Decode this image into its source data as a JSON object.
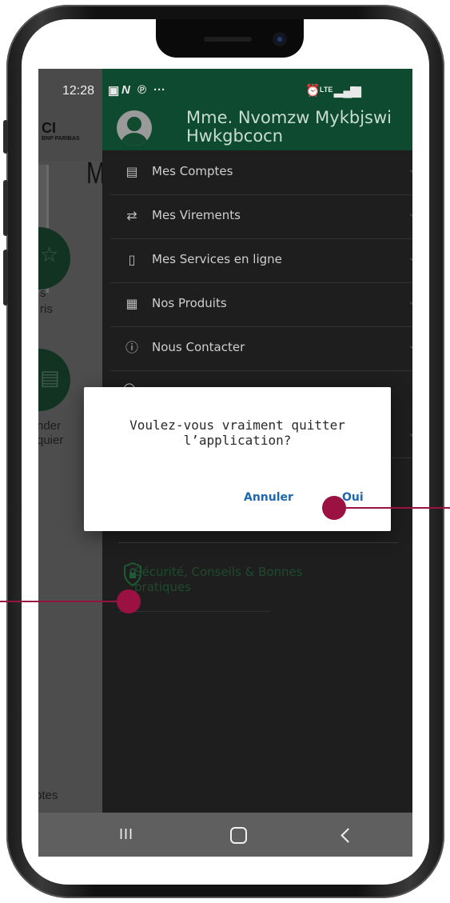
{
  "status_bar": {
    "time": "12:28",
    "left_icons": [
      "image-icon",
      "n-icon",
      "pinterest-icon",
      "more-icon"
    ],
    "right_icons": [
      "alarm-icon",
      "lte-icon",
      "signal-icon",
      "battery-icon"
    ],
    "lte_label": "LTE"
  },
  "background_app": {
    "logo": "CI",
    "logo_sub": "BNP PARIBAS",
    "title_letter": "M",
    "fav_line1": "s",
    "fav_line2": "ris",
    "demand_line1": "nder",
    "demand_line2": "quier",
    "comptes": "ptes"
  },
  "drawer": {
    "user_name": "Mme. Nvomzw Mykbjswi Hwkgbcocn",
    "menu": [
      {
        "label": "Mes Comptes",
        "icon": "accounts-icon"
      },
      {
        "label": "Mes Virements",
        "icon": "transfers-icon"
      },
      {
        "label": "Mes Services en ligne",
        "icon": "online-services-icon"
      },
      {
        "label": "Nos Produits",
        "icon": "products-icon"
      },
      {
        "label": "Nous Contacter",
        "icon": "info-icon"
      }
    ],
    "security_label": "Sécurité, Conseils & Bonnes pratiques"
  },
  "dialog": {
    "message": "Voulez-vous vraiment quitter l’application?",
    "cancel_label": "Annuler",
    "ok_label": "Oui"
  },
  "nav_bar": {
    "recent_label": "III"
  },
  "colors": {
    "brand_green": "#0e4a30",
    "link_blue": "#1a68b4",
    "annotation": "#9b1142"
  }
}
